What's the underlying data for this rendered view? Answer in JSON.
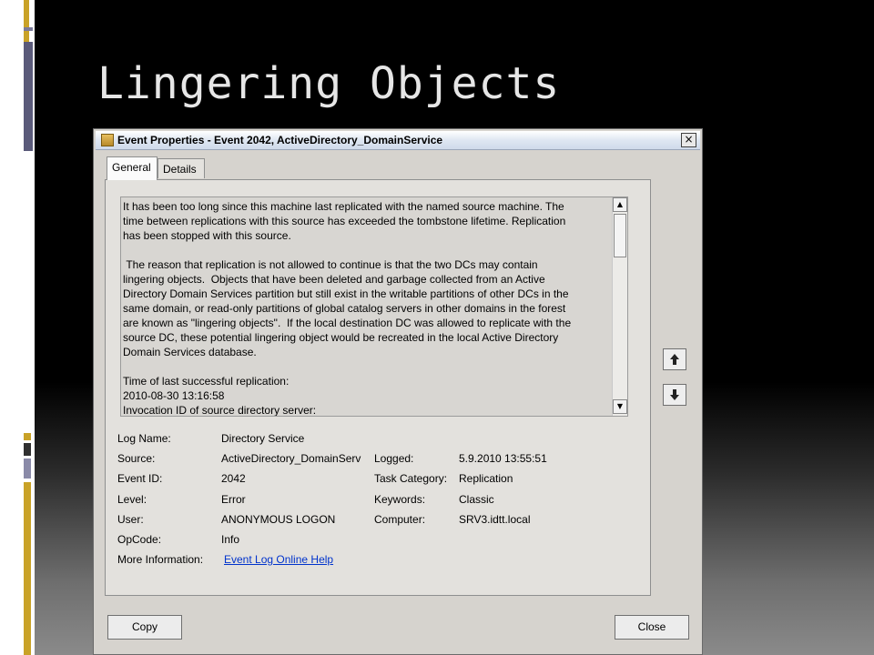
{
  "slide": {
    "title": "Lingering Objects"
  },
  "dialog": {
    "title": "Event Properties - Event 2042, ActiveDirectory_DomainService",
    "close_symbol": "×",
    "tabs": [
      {
        "label": "General",
        "selected": true
      },
      {
        "label": "Details",
        "selected": false
      }
    ],
    "description": "It has been too long since this machine last replicated with the named source machine. The\ntime between replications with this source has exceeded the tombstone lifetime. Replication\nhas been stopped with this source.\n\n The reason that replication is not allowed to continue is that the two DCs may contain\nlingering objects.  Objects that have been deleted and garbage collected from an Active\nDirectory Domain Services partition but still exist in the writable partitions of other DCs in the\nsame domain, or read-only partitions of global catalog servers in other domains in the forest\nare known as \"lingering objects\".  If the local destination DC was allowed to replicate with the\nsource DC, these potential lingering object would be recreated in the local Active Directory\nDomain Services database.\n\nTime of last successful replication:\n2010-08-30 13:16:58\nInvocation ID of source directory server:",
    "fields": {
      "log_name": {
        "label": "Log Name:",
        "value": "Directory Service"
      },
      "source": {
        "label": "Source:",
        "value": "ActiveDirectory_DomainServ"
      },
      "event_id": {
        "label": "Event ID:",
        "value": "2042"
      },
      "level": {
        "label": "Level:",
        "value": "Error"
      },
      "user": {
        "label": "User:",
        "value": "ANONYMOUS LOGON"
      },
      "opcode": {
        "label": "OpCode:",
        "value": "Info"
      },
      "more_info": {
        "label": "More Information:",
        "value": "Event Log Online Help"
      },
      "logged": {
        "label": "Logged:",
        "value": "5.9.2010 13:55:51"
      },
      "task_category": {
        "label": "Task Category:",
        "value": "Replication"
      },
      "keywords": {
        "label": "Keywords:",
        "value": "Classic"
      },
      "computer": {
        "label": "Computer:",
        "value": "SRV3.idtt.local"
      }
    },
    "buttons": {
      "copy": "Copy",
      "close": "Close"
    }
  },
  "icons": {
    "app": "event-viewer-icon",
    "prev": "arrow-up-icon",
    "next": "arrow-down-icon"
  },
  "colors": {
    "link": "#0033cc",
    "slide_title": "#e6e6e6",
    "accent_bar": "#c9a227"
  }
}
